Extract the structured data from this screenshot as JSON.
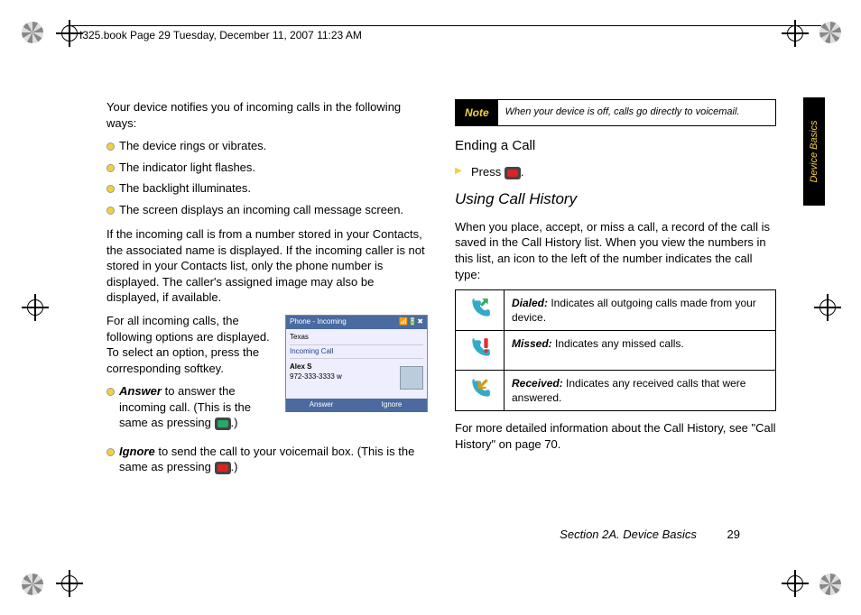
{
  "header": "I325.book  Page 29  Tuesday, December 11, 2007  11:23 AM",
  "sideTab": "Device Basics",
  "left": {
    "intro": "Your device notifies you of incoming calls in the following ways:",
    "bullets1": [
      "The device rings or vibrates.",
      "The indicator light flashes.",
      "The backlight illuminates.",
      "The screen displays an incoming call message screen."
    ],
    "para2": "If the incoming call is from a number stored in your Contacts, the associated name is displayed. If the incoming caller is not stored in your Contacts list, only the phone number is displayed. The caller's assigned image may also be displayed, if available.",
    "para3": "For all incoming calls, the following options are displayed. To select an option, press the corresponding softkey.",
    "answer": {
      "term": "Answer",
      "text": " to answer the incoming call. (This is the same as pressing ",
      "tail": ".)"
    },
    "ignore": {
      "term": "Ignore",
      "text": " to send the call to your voicemail box. (This is the same as pressing ",
      "tail": ".)"
    },
    "screenshot": {
      "title": "Phone - Incoming",
      "icons": "📶🔋✖",
      "row1": "Texas",
      "row2": "Incoming Call",
      "name": "Alex S",
      "num": "972-333-3333 w",
      "btnL": "Answer",
      "btnR": "Ignore"
    }
  },
  "right": {
    "note": {
      "label": "Note",
      "text": "When your device is off, calls go directly to voicemail."
    },
    "h_ending": "Ending a Call",
    "press": "Press ",
    "period": ".",
    "h_using": "Using Call History",
    "para1": "When you place, accept, or miss a call, a record of the call is saved in the Call History list. When you view the numbers in this list, an icon to the left of the number indicates the call type:",
    "table": [
      {
        "term": "Dialed:",
        "text": " Indicates all outgoing calls made from your device."
      },
      {
        "term": "Missed:",
        "text": " Indicates any missed calls."
      },
      {
        "term": "Received:",
        "text": " Indicates any received calls that were answered."
      }
    ],
    "para2": "For more detailed information about the Call History, see \"Call History\" on page 70."
  },
  "footer": {
    "section": "Section 2A. Device Basics",
    "page": "29"
  }
}
